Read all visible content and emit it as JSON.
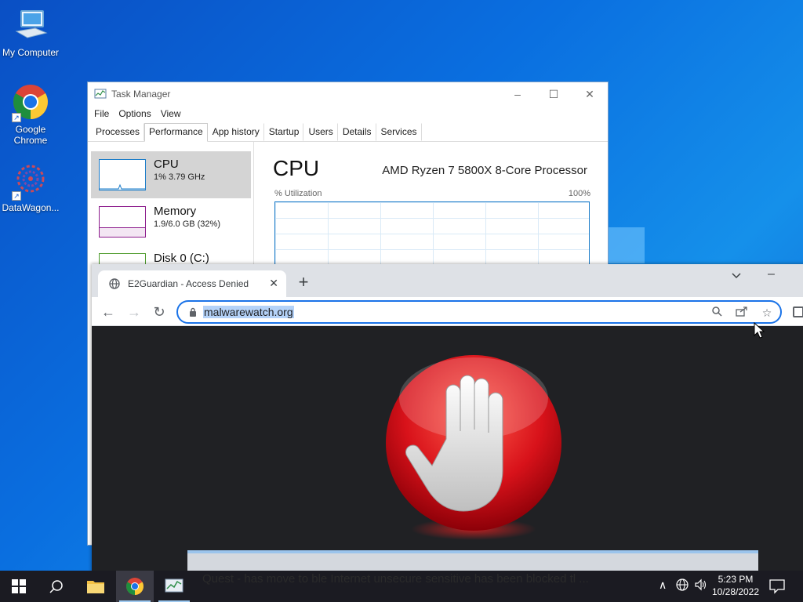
{
  "desktop": {
    "icons": [
      {
        "label": "My Computer"
      },
      {
        "label": "Google Chrome"
      },
      {
        "label": "DataWagon..."
      }
    ]
  },
  "task_manager": {
    "title": "Task Manager",
    "menu": [
      "File",
      "Options",
      "View"
    ],
    "tabs": [
      "Processes",
      "Performance",
      "App history",
      "Startup",
      "Users",
      "Details",
      "Services"
    ],
    "active_tab": "Performance",
    "side_items": [
      {
        "name": "CPU",
        "sub": "1% 3.79 GHz",
        "color": "#1b7cc9"
      },
      {
        "name": "Memory",
        "sub": "1.9/6.0 GB (32%)",
        "color": "#8b1a8b"
      },
      {
        "name": "Disk 0 (C:)",
        "sub": "",
        "color": "#4c9a2a"
      }
    ],
    "main": {
      "title": "CPU",
      "processor": "AMD Ryzen 7 5800X 8-Core Processor",
      "util_label": "% Utilization",
      "max_label": "100%"
    }
  },
  "browser": {
    "tab_title": "E2Guardian - Access Denied",
    "new_tab_label": "+",
    "url": "malwarewatch.org",
    "content_icon": "stop-hand-icon"
  },
  "taskbar": {
    "ticker": "Quest - has move to  ble  Internet  unsecure  sensitive  has  been  blocked  tl  ...",
    "clock_time": "5:23 PM",
    "clock_date": "10/28/2022",
    "apps": [
      "start-icon",
      "search-icon",
      "file-explorer-icon",
      "chrome-icon",
      "task-manager-icon"
    ]
  }
}
